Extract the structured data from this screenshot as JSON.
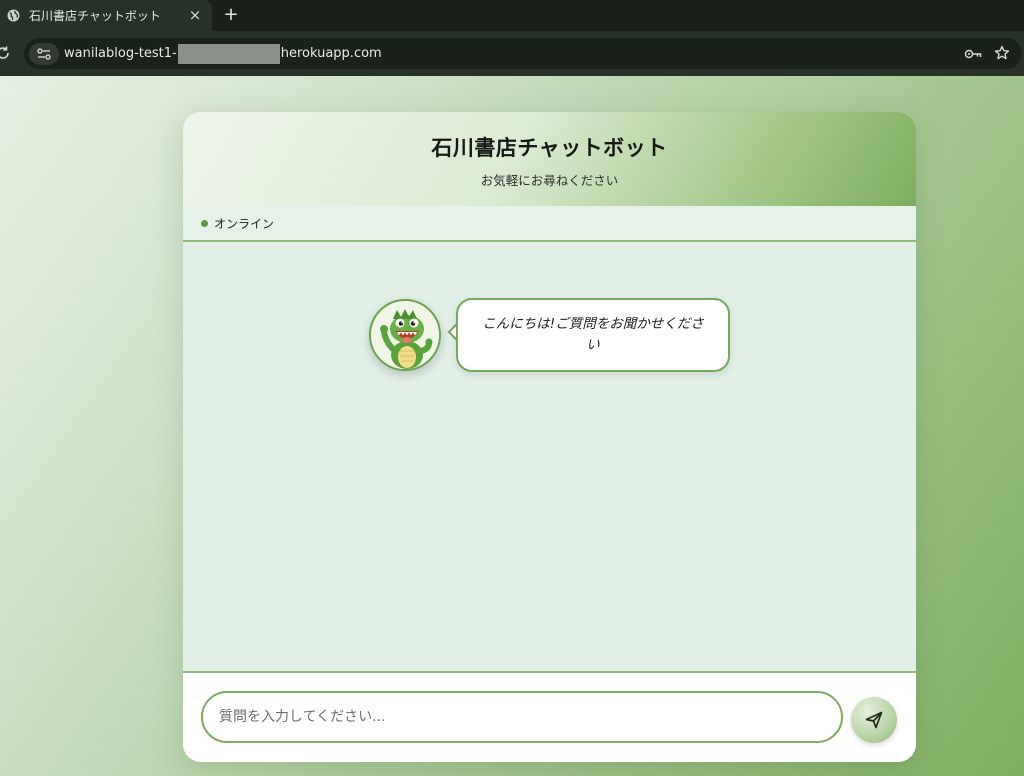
{
  "browser": {
    "tab_title": "石川書店チャットボット",
    "tab_close": "×",
    "new_tab": "+",
    "url_prefix": "wanilablog-test1-",
    "url_suffix": "herokuapp.com"
  },
  "chat": {
    "title": "石川書店チャットボット",
    "subtitle": "お気軽にお尋ねください",
    "status_label": "オンライン",
    "messages": [
      {
        "sender": "bot",
        "text": "こんにちは!ご質問をお聞かせください"
      }
    ],
    "input_placeholder": "質問を入力してください..."
  },
  "colors": {
    "accent": "#7aad5f",
    "status_online": "#5d9a45",
    "chat_background": "#e1efe6"
  }
}
